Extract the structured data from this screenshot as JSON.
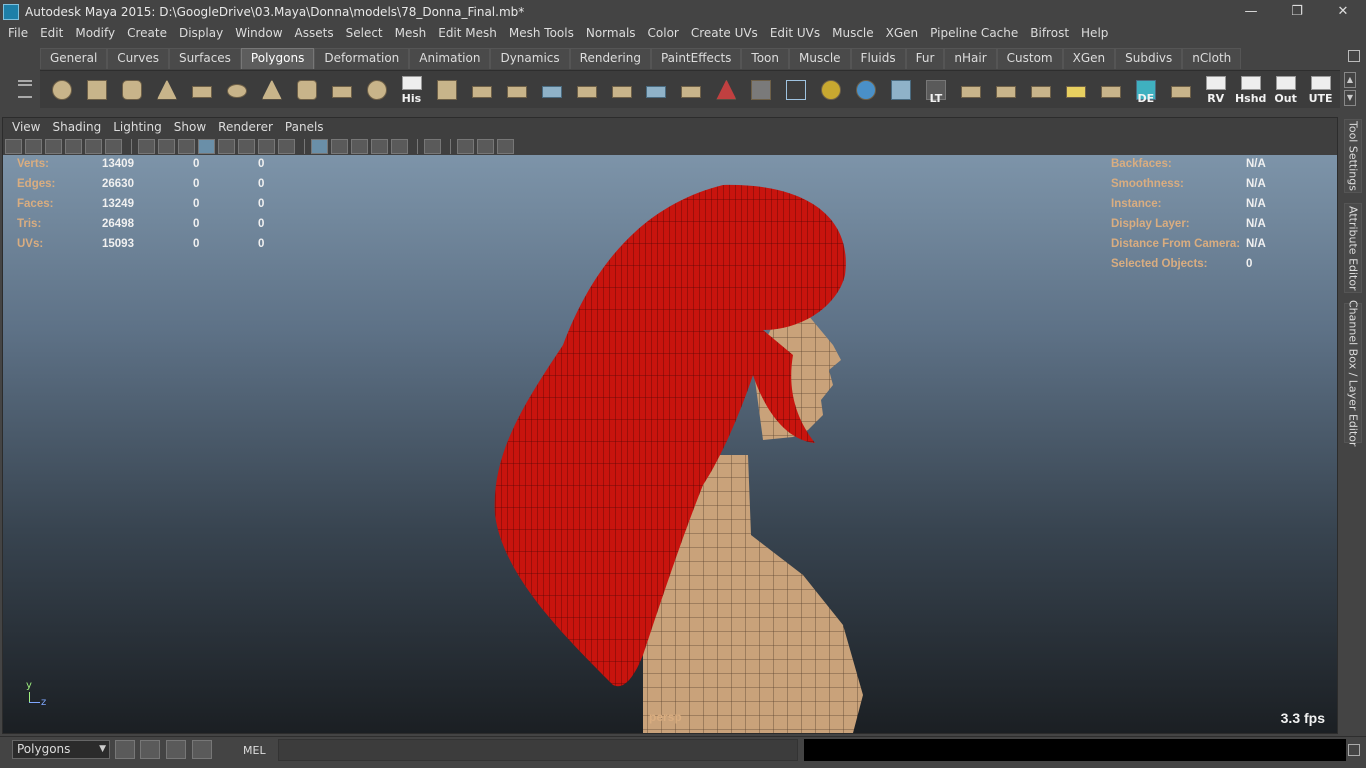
{
  "window": {
    "title": "Autodesk Maya 2015: D:\\GoogleDrive\\03.Maya\\Donna\\models\\78_Donna_Final.mb*",
    "minimize": "—",
    "restore": "❐",
    "close": "✕"
  },
  "menus": [
    "File",
    "Edit",
    "Modify",
    "Create",
    "Display",
    "Window",
    "Assets",
    "Select",
    "Mesh",
    "Edit Mesh",
    "Mesh Tools",
    "Normals",
    "Color",
    "Create UVs",
    "Edit UVs",
    "Muscle",
    "XGen",
    "Pipeline Cache",
    "Bifrost",
    "Help"
  ],
  "shelf": {
    "tabs": [
      "General",
      "Curves",
      "Surfaces",
      "Polygons",
      "Deformation",
      "Animation",
      "Dynamics",
      "Rendering",
      "PaintEffects",
      "Toon",
      "Muscle",
      "Fluids",
      "Fur",
      "nHair",
      "Custom",
      "XGen",
      "Subdivs",
      "nCloth"
    ],
    "active_tab": "Polygons",
    "icon_labels": {
      "history": "His",
      "lt": "LT",
      "de": "DE",
      "rv": "RV",
      "hshd": "Hshd",
      "out": "Out",
      "ute": "UTE"
    }
  },
  "panel_menu": [
    "View",
    "Shading",
    "Lighting",
    "Show",
    "Renderer",
    "Panels"
  ],
  "hud": {
    "left": [
      {
        "label": "Verts:",
        "value": "13409",
        "c1": "0",
        "c2": "0"
      },
      {
        "label": "Edges:",
        "value": "26630",
        "c1": "0",
        "c2": "0"
      },
      {
        "label": "Faces:",
        "value": "13249",
        "c1": "0",
        "c2": "0"
      },
      {
        "label": "Tris:",
        "value": "26498",
        "c1": "0",
        "c2": "0"
      },
      {
        "label": "UVs:",
        "value": "15093",
        "c1": "0",
        "c2": "0"
      }
    ],
    "right": [
      {
        "label": "Backfaces:",
        "value": "N/A"
      },
      {
        "label": "Smoothness:",
        "value": "N/A"
      },
      {
        "label": "Instance:",
        "value": "N/A"
      },
      {
        "label": "Display Layer:",
        "value": "N/A"
      },
      {
        "label": "Distance From Camera:",
        "value": "N/A"
      },
      {
        "label": "Selected Objects:",
        "value": "0"
      }
    ],
    "camera": "persp",
    "fps": "3.3 fps",
    "axis_y": "y",
    "axis_z": "z"
  },
  "side_tabs": [
    "Tool Settings",
    "Attribute Editor",
    "Channel Box / Layer Editor"
  ],
  "bottom": {
    "menu_set": "Polygons",
    "script_lang": "MEL"
  },
  "colors": {
    "hair": "#c8140e",
    "skin": "#c9a27a",
    "hud_label": "#d9ad80"
  }
}
